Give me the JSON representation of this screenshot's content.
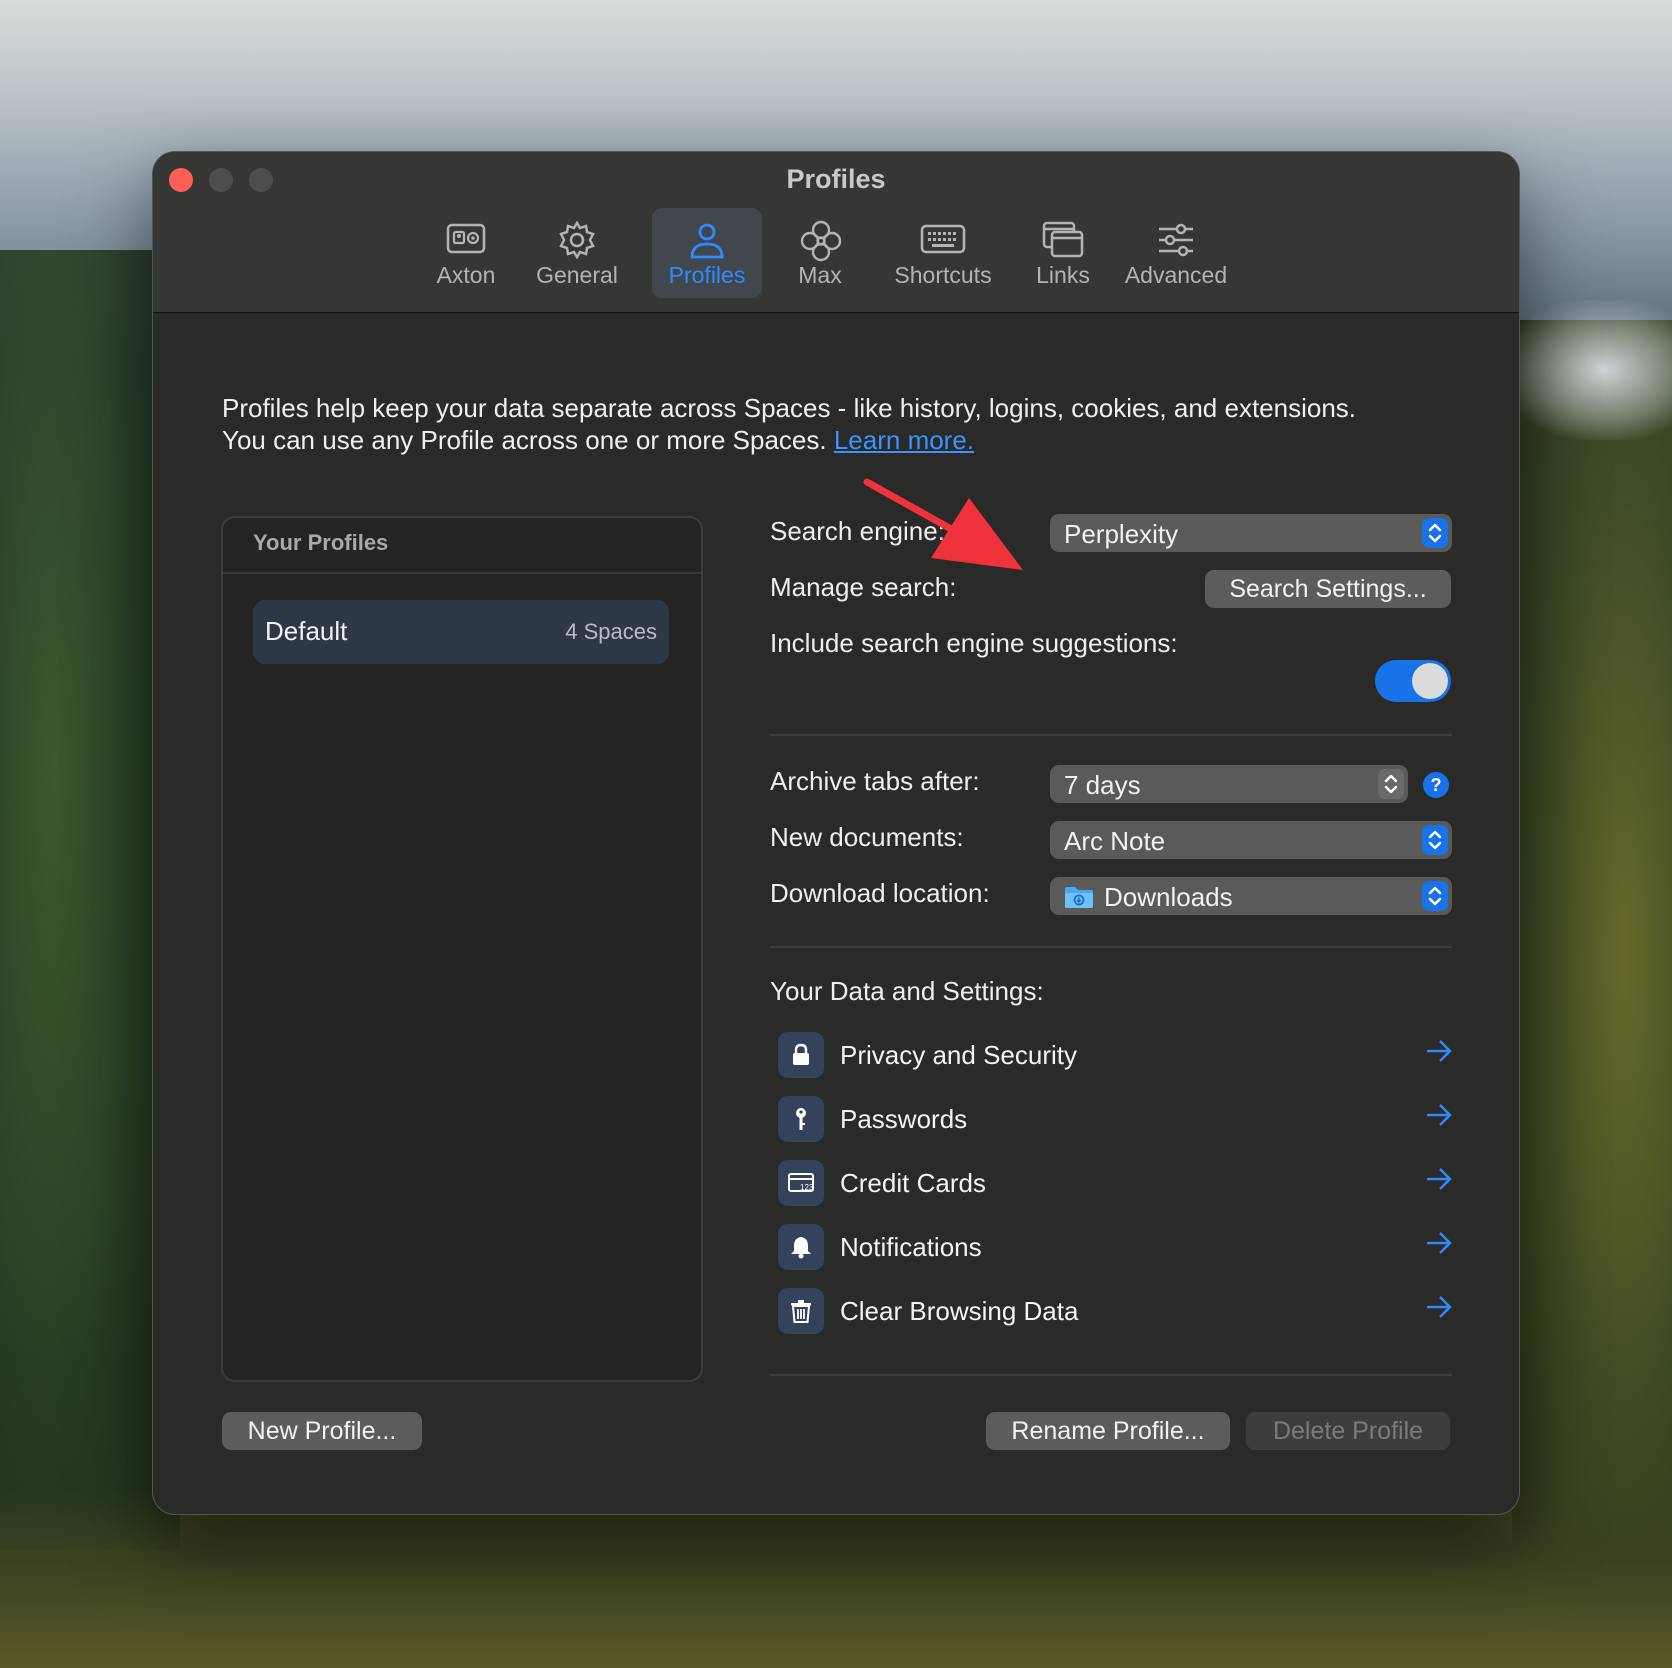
{
  "window": {
    "title": "Profiles"
  },
  "tabs": [
    {
      "label": "Axton",
      "icon": "contact-card-icon",
      "active": false
    },
    {
      "label": "General",
      "icon": "gear-icon",
      "active": false
    },
    {
      "label": "Profiles",
      "icon": "person-icon",
      "active": true
    },
    {
      "label": "Max",
      "icon": "flower-icon",
      "active": false
    },
    {
      "label": "Shortcuts",
      "icon": "keyboard-icon",
      "active": false
    },
    {
      "label": "Links",
      "icon": "windows-icon",
      "active": false
    },
    {
      "label": "Advanced",
      "icon": "sliders-icon",
      "active": false
    }
  ],
  "intro": {
    "line1": "Profiles help keep your data separate across Spaces - like history, logins, cookies, and extensions.",
    "line2": "You can use any Profile across one or more Spaces.",
    "link": "Learn more."
  },
  "profiles_panel": {
    "heading": "Your Profiles",
    "items": [
      {
        "name": "Default",
        "count": "4 Spaces"
      }
    ]
  },
  "settings": {
    "search_engine_label": "Search engine:",
    "search_engine_value": "Perplexity",
    "manage_search_label": "Manage search:",
    "manage_search_button": "Search Settings...",
    "suggestions_label": "Include search engine suggestions:",
    "suggestions_on": true,
    "archive_label": "Archive tabs after:",
    "archive_value": "7 days",
    "help_glyph": "?",
    "new_docs_label": "New documents:",
    "new_docs_value": "Arc Note",
    "download_label": "Download location:",
    "download_value": "Downloads"
  },
  "data_settings": {
    "heading": "Your Data and Settings:",
    "items": [
      {
        "label": "Privacy and Security",
        "icon": "lock-icon"
      },
      {
        "label": "Passwords",
        "icon": "key-icon"
      },
      {
        "label": "Credit Cards",
        "icon": "credit-card-icon"
      },
      {
        "label": "Notifications",
        "icon": "bell-icon"
      },
      {
        "label": "Clear Browsing Data",
        "icon": "trash-icon"
      }
    ]
  },
  "footer": {
    "new_profile": "New Profile...",
    "rename_profile": "Rename Profile...",
    "delete_profile": "Delete Profile"
  },
  "colors": {
    "accent": "#1a72e8",
    "link": "#3a93ff",
    "annotation_arrow": "#f0323c",
    "close_button": "#fe5f57"
  }
}
